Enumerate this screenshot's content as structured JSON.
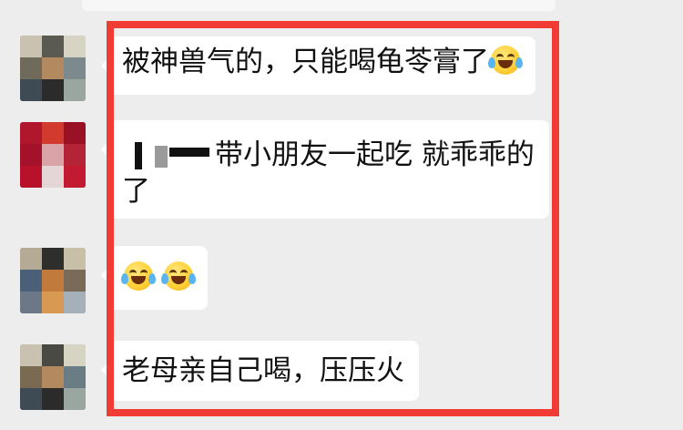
{
  "chat": {
    "messages": [
      {
        "text": "被神兽气的，只能喝龟苓膏了",
        "emoji": "laughing-tears-emoji"
      },
      {
        "text_line1": "带小朋友一起吃 就乖乖的",
        "text_line2": "了",
        "has_redacted_name": true
      },
      {
        "emoji_count": 2,
        "emoji": "laughing-tears-emoji"
      },
      {
        "text": "老母亲自己喝，压压火"
      }
    ]
  },
  "colors": {
    "background": "#ededed",
    "bubble": "#ffffff",
    "highlight_border": "#f03c34",
    "text": "#111111"
  }
}
